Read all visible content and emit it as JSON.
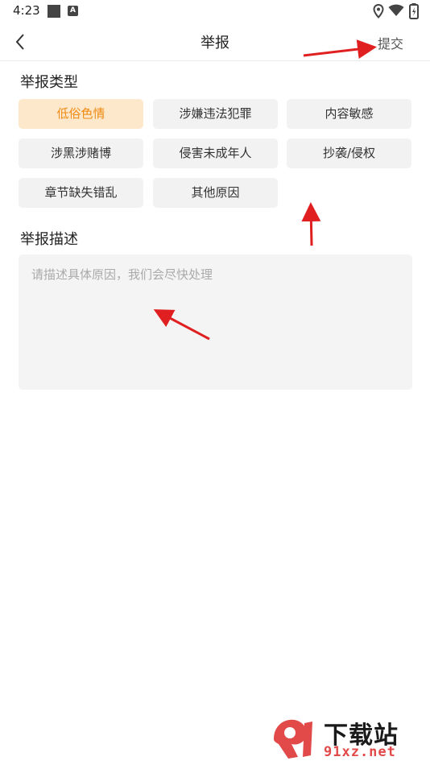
{
  "status_bar": {
    "time": "4:23",
    "notification_icons": [
      "square-icon",
      "a-icon"
    ],
    "a_icon_letter": "A",
    "system_icons": [
      "location-icon",
      "wifi-icon",
      "battery-icon"
    ]
  },
  "header": {
    "title": "举报",
    "submit_label": "提交",
    "back_icon": "chevron-left-icon"
  },
  "report_types": {
    "label": "举报类型",
    "options": [
      {
        "label": "低俗色情",
        "selected": true
      },
      {
        "label": "涉嫌违法犯罪",
        "selected": false
      },
      {
        "label": "内容敏感",
        "selected": false
      },
      {
        "label": "涉黑涉赌博",
        "selected": false
      },
      {
        "label": "侵害未成年人",
        "selected": false
      },
      {
        "label": "抄袭/侵权",
        "selected": false
      },
      {
        "label": "章节缺失错乱",
        "selected": false
      },
      {
        "label": "其他原因",
        "selected": false
      }
    ]
  },
  "description": {
    "label": "举报描述",
    "placeholder": "请描述具体原因，我们会尽快处理",
    "value": ""
  },
  "colors": {
    "selected_bg": "#fde8cc",
    "selected_text": "#f08a12",
    "chip_bg": "#f2f2f2",
    "arrow": "#e02020"
  },
  "watermark": {
    "text_main": "下载站",
    "text_url": "91xz.net"
  }
}
